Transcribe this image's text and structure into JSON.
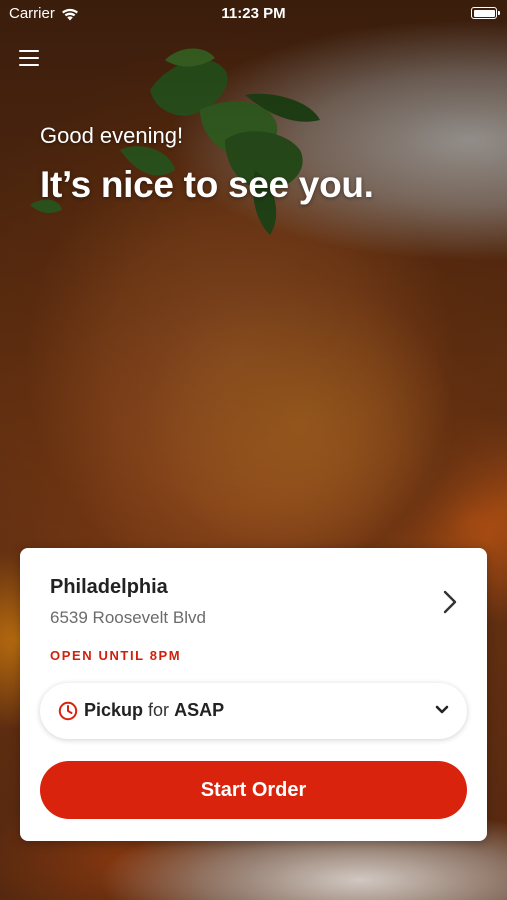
{
  "status_bar": {
    "carrier": "Carrier",
    "time": "11:23 PM",
    "wifi_icon": "wifi-icon",
    "battery_icon": "battery-icon"
  },
  "header": {
    "menu_icon": "hamburger-menu-icon"
  },
  "hero": {
    "greeting": "Good evening!",
    "headline": "It’s nice to see you."
  },
  "location": {
    "name": "Philadelphia",
    "address": "6539 Roosevelt Blvd",
    "hours": "OPEN UNTIL 8PM",
    "chevron_icon": "chevron-right-icon"
  },
  "pickup": {
    "mode": "Pickup",
    "connector": "for",
    "time": "ASAP",
    "clock_icon": "clock-icon",
    "dropdown_icon": "chevron-down-icon"
  },
  "actions": {
    "start_order_label": "Start Order"
  },
  "colors": {
    "accent": "#d9230c",
    "hours_text": "#d0210d",
    "card_background": "#ffffff"
  }
}
